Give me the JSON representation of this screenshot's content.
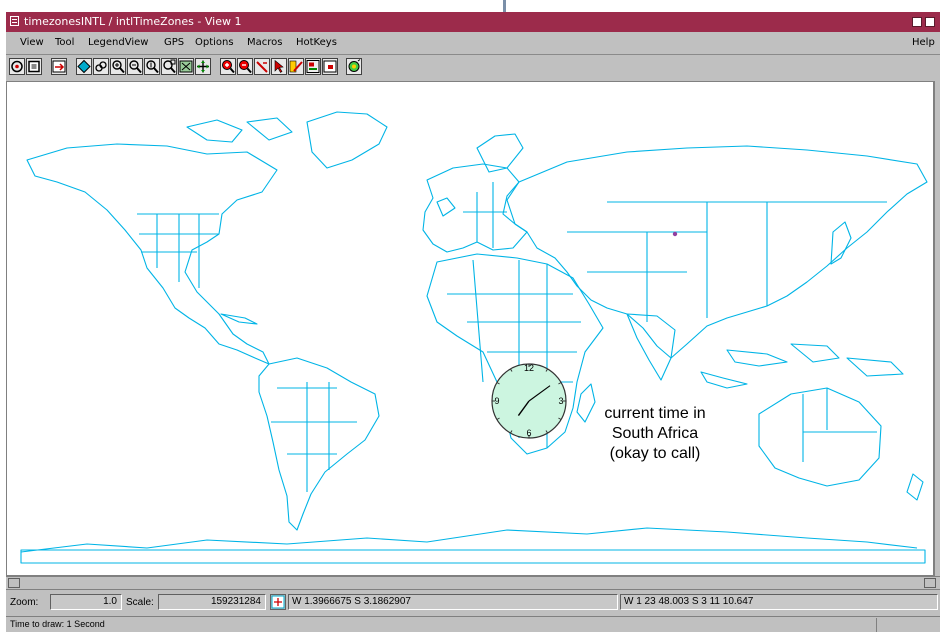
{
  "window": {
    "title": "timezonesINTL / intlTimeZones - View 1"
  },
  "menu": {
    "items": [
      "View",
      "Tool",
      "LegendView",
      "GPS",
      "Options",
      "Macros",
      "HotKeys"
    ],
    "help": "Help"
  },
  "toolbar": {
    "icons": [
      "full-view-icon",
      "view-box-icon",
      "redraw-icon",
      "select-icon",
      "pan-icon",
      "zoom-in-icon",
      "zoom-out-icon",
      "zoom-one-icon",
      "zoom-box-icon",
      "zoom-layer-icon",
      "grid-icon",
      "zoom-red-in-icon",
      "zoom-red-out-icon",
      "sketch-icon",
      "pointer-icon",
      "legend-icon",
      "layout-icon",
      "frame-icon",
      "gps-icon"
    ]
  },
  "map": {
    "line_color": "#00b4e6",
    "clock": {
      "numbers": [
        "12",
        "3",
        "6",
        "9"
      ],
      "face_color": "#ccf5e0",
      "hour": 7.2,
      "minute": 9
    },
    "annotation": {
      "line1": "current time in",
      "line2": "South Africa",
      "line3": "(okay to call)"
    }
  },
  "status": {
    "zoom_label": "Zoom:",
    "zoom_value": "1.0",
    "scale_label": "Scale:",
    "scale_value": "159231284",
    "coord1": "W 1.3966675  S 3.1862907",
    "coord2": "W 1 23 48.003  S 3 11 10.647",
    "time_to_draw": "Time to draw: 1 Second"
  }
}
